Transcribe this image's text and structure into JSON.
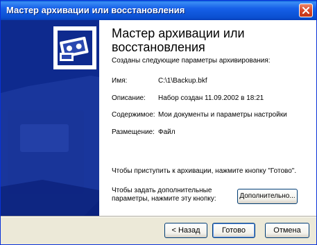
{
  "window": {
    "title": "Мастер архивации или восстановления"
  },
  "wizard": {
    "heading": "Мастер архивации или восстановления",
    "intro": "Созданы следующие параметры архивирования:",
    "rows": [
      {
        "label": "Имя:",
        "value": "C:\\1\\Backup.bkf"
      },
      {
        "label": "Описание:",
        "value": "Набор создан 11.09.2002 в 18:21"
      },
      {
        "label": "Содержимое:",
        "value": "Мои документы и параметры настройки"
      },
      {
        "label": "Размещение:",
        "value": "Файл"
      }
    ],
    "finish_note": "Чтобы приступить к архивации, нажмите кнопку \"Готово\".",
    "advanced_note": "Чтобы задать дополнительные параметры, нажмите эту кнопку:",
    "advanced_button": "Дополнительно..."
  },
  "buttons": {
    "back": "< Назад",
    "finish": "Готово",
    "cancel": "Отмена"
  },
  "icons": {
    "close": "close-icon",
    "wizard": "backup-tape-icon"
  },
  "colors": {
    "titlebar": "#0a5fd8",
    "side_panel": "#0e2a8e",
    "close_button": "#d9472a",
    "dialog_face": "#ece9d8"
  }
}
